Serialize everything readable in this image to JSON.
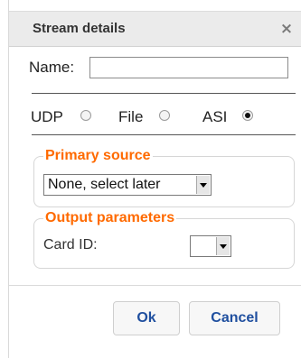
{
  "dialog": {
    "title": "Stream details",
    "close_icon": "×"
  },
  "name": {
    "label": "Name:",
    "value": ""
  },
  "source_type": {
    "options": [
      {
        "label": "UDP",
        "checked": false
      },
      {
        "label": "File",
        "checked": false
      },
      {
        "label": "ASI",
        "checked": true
      }
    ]
  },
  "primary_source": {
    "legend": "Primary source",
    "selected": "None, select later"
  },
  "output_parameters": {
    "legend": "Output parameters",
    "card_id_label": "Card ID:",
    "card_id_selected": ""
  },
  "buttons": {
    "ok_label": "Ok",
    "cancel_label": "Cancel"
  },
  "colors": {
    "legend": "#ff6a00",
    "button_text": "#1f4f9f",
    "titlebar": "#ebebeb"
  }
}
